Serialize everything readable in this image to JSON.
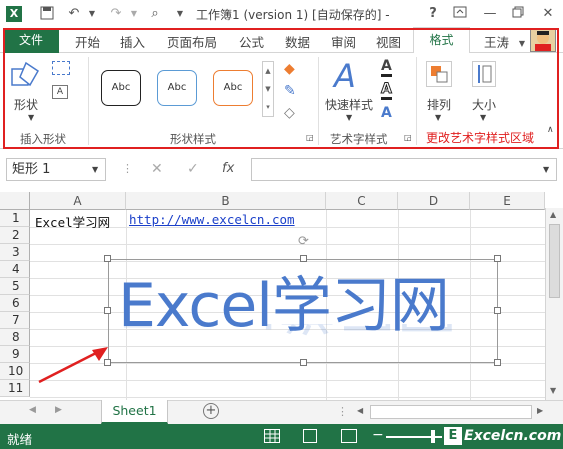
{
  "titlebar": {
    "title": "工作簿1 (version 1) [自动保存的] -",
    "help": "?",
    "minimize": "—",
    "close": "✕"
  },
  "ribbon": {
    "tabs": [
      "文件",
      "开始",
      "插入",
      "页面布局",
      "公式",
      "数据",
      "审阅",
      "视图",
      "格式"
    ],
    "user": "王涛",
    "groups": {
      "insert_shapes": {
        "label": "插入形状",
        "shape_btn": "形状"
      },
      "shape_styles": {
        "label": "形状样式",
        "styles": [
          "Abc",
          "Abc",
          "Abc"
        ]
      },
      "wordart_styles": {
        "label": "艺术字样式",
        "quick_styles": "快速样式"
      },
      "arrange": {
        "label": "排列"
      },
      "size": {
        "label": "大小"
      }
    },
    "annotation": "更改艺术字样式区域"
  },
  "formula_bar": {
    "name_box": "矩形 1",
    "fx": "fx"
  },
  "sheet": {
    "columns": [
      "A",
      "B",
      "C",
      "D",
      "E"
    ],
    "rows": [
      "1",
      "2",
      "3",
      "4",
      "5",
      "6",
      "7",
      "8",
      "9",
      "10",
      "11"
    ],
    "cells": {
      "A1": "Excel学习网",
      "B1": "http://www.excelcn.com"
    },
    "wordart": "Excel学习网",
    "sheet_tab": "Sheet1"
  },
  "status": {
    "text": "就绪",
    "watermark": "Excelcn.com"
  },
  "colors": {
    "accent": "#217346",
    "annotation_red": "#e02020",
    "wordart_blue": "#4a7acc"
  }
}
